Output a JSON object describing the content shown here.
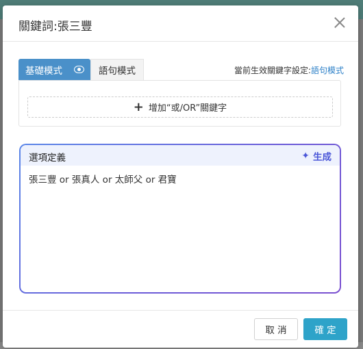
{
  "dialog": {
    "title": "關鍵詞:張三豐"
  },
  "tabs": {
    "basic_label": "基礎模式",
    "sentence_label": "語句模式"
  },
  "current_setting": {
    "prefix": "當前生效關鍵字設定:",
    "mode": "語句模式"
  },
  "keyword_panel": {
    "add_label": "增加“或/OR”關鍵字"
  },
  "definition": {
    "title": "選項定義",
    "generate_label": "生成",
    "text": "張三豐 or 張真人 or 太師父 or 君寶"
  },
  "footer": {
    "cancel_label": "取 消",
    "ok_label": "確 定"
  },
  "colors": {
    "accent": "#4a90c9",
    "primary_button": "#2ea3c9",
    "link": "#2b7fc7",
    "generate": "#4a56d8"
  }
}
